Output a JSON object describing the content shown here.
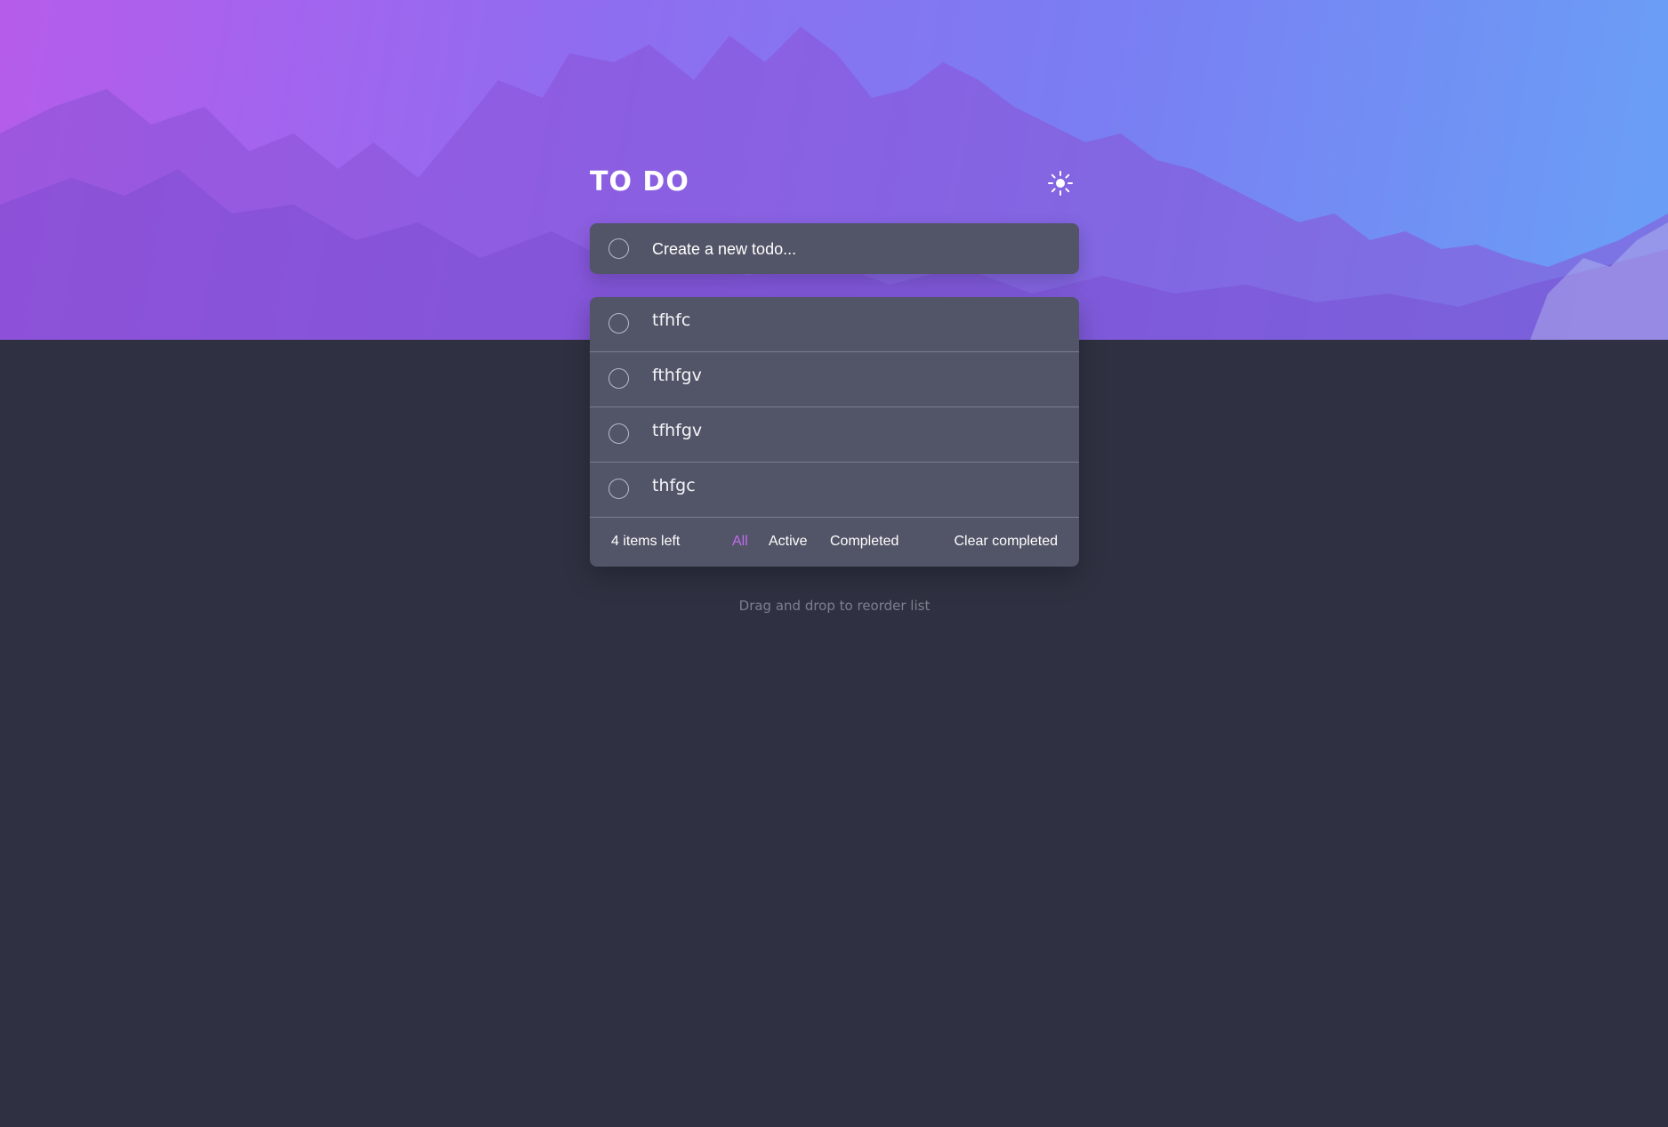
{
  "header": {
    "title": "TO DO",
    "theme_icon": "sun-icon"
  },
  "new_todo": {
    "placeholder": "Create a new todo..."
  },
  "todos": [
    {
      "label": "tfhfc",
      "completed": false
    },
    {
      "label": "fthfgv",
      "completed": false
    },
    {
      "label": "tfhfgv",
      "completed": false
    },
    {
      "label": "thfgc",
      "completed": false
    }
  ],
  "footer": {
    "items_left": "4 items left",
    "filters": {
      "all": "All",
      "active": "Active",
      "completed": "Completed"
    },
    "active_filter": "all",
    "clear_completed": "Clear completed"
  },
  "hint": "Drag and drop to reorder list",
  "colors": {
    "background": "#2f3142",
    "card": "#525467",
    "accent": "#c26cf0",
    "gradient_start": "#b65ceb",
    "gradient_end": "#69a0f6"
  }
}
